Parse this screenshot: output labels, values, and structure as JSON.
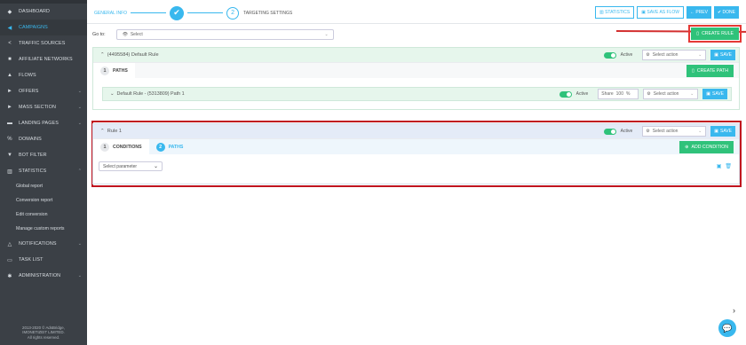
{
  "sidebar": {
    "items": [
      {
        "label": "DASHBOARD",
        "icon": "dashboard-icon",
        "glyph": "◆"
      },
      {
        "label": "CAMPAIGNS",
        "icon": "campaigns-icon",
        "glyph": "◀"
      },
      {
        "label": "TRAFFIC SOURCES",
        "icon": "share-icon",
        "glyph": "<"
      },
      {
        "label": "AFFILIATE NETWORKS",
        "icon": "briefcase-icon",
        "glyph": "■"
      },
      {
        "label": "FLOWS",
        "icon": "sitemap-icon",
        "glyph": "▲"
      },
      {
        "label": "OFFERS",
        "icon": "tag-icon",
        "glyph": "►"
      },
      {
        "label": "MASS SECTION",
        "icon": "tags-icon",
        "glyph": "►"
      },
      {
        "label": "LANDING PAGES",
        "icon": "list-icon",
        "glyph": "▬"
      },
      {
        "label": "DOMAINS",
        "icon": "link-icon",
        "glyph": "%"
      },
      {
        "label": "BOT FILTER",
        "icon": "filter-icon",
        "glyph": "▼"
      },
      {
        "label": "STATISTICS",
        "icon": "bar-chart-icon",
        "glyph": "▥"
      }
    ],
    "sub_items": [
      "Global report",
      "Conversion report",
      "Edit conversion",
      "Manage custom reports"
    ],
    "items_bottom": [
      {
        "label": "NOTIFICATIONS",
        "icon": "bell-icon",
        "glyph": "△"
      },
      {
        "label": "TASK LIST",
        "icon": "tasks-icon",
        "glyph": "▭"
      },
      {
        "label": "ADMINISTRATION",
        "icon": "gear-icon",
        "glyph": "✱"
      }
    ],
    "footer": [
      "2013-2020 © AdsBridge,",
      "IMONETIZEIT LIMITED.",
      "All rights reserved."
    ]
  },
  "wizard": {
    "step1_label": "GENERAL INFO",
    "step2_number": "2",
    "step2_label": "TARGETING SETTINGS"
  },
  "toolbar": {
    "statistics": "STATISTICS",
    "save_as_flow": "SAVE AS FLOW",
    "prev": "← PREV",
    "done": "✔ DONE"
  },
  "goto": {
    "label": "Go to:",
    "select": "Select"
  },
  "create_rule": "CREATE RULE",
  "default_rule": {
    "title": "(4495584) Default Rule",
    "active": "Active",
    "select_action": "Select action",
    "save": "SAVE",
    "tab_paths_num": "1",
    "tab_paths": "PATHS",
    "create_path": "CREATE PATH",
    "path": {
      "title": "Default Rule - (5313809) Path 1",
      "active": "Active",
      "share_label": "Share",
      "share_value": "100",
      "share_unit": "%",
      "select_action": "Select action",
      "save": "SAVE"
    }
  },
  "rule1": {
    "title": "Rule 1",
    "active": "Active",
    "select_action": "Select action",
    "save": "SAVE",
    "tab_conditions_num": "1",
    "tab_conditions": "CONDITIONS",
    "tab_paths_num": "2",
    "tab_paths": "PATHS",
    "add_condition": "ADD CONDITION",
    "select_parameter": "Select parameter"
  },
  "colors": {
    "accent": "#39b8ee",
    "success": "#2fc27a",
    "highlight": "#c0141f",
    "sidebar": "#3b4046"
  }
}
